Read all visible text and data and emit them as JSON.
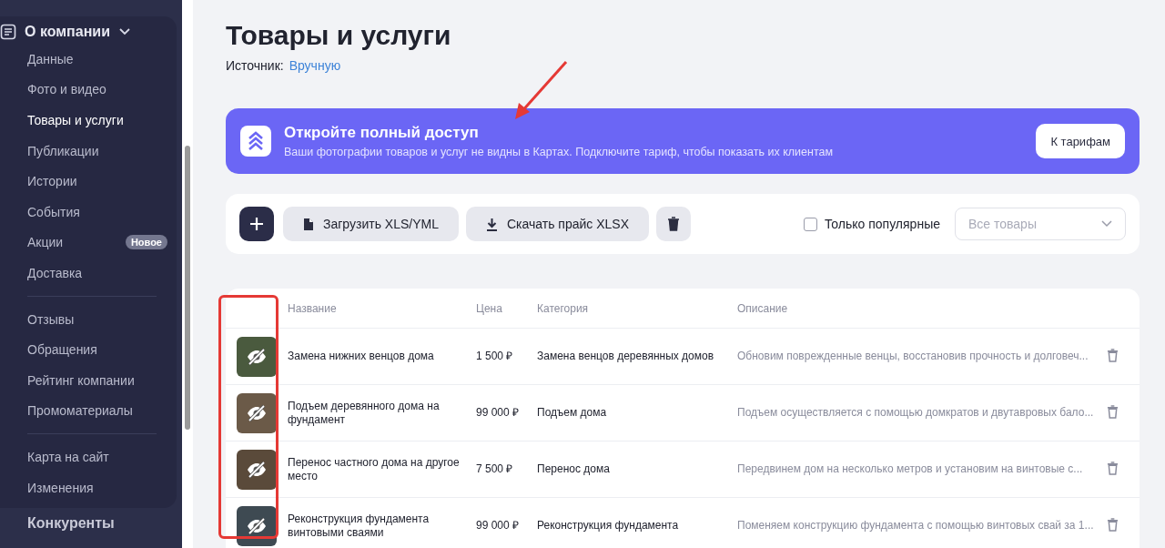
{
  "sidebar": {
    "section": {
      "title": "О компании",
      "expanded": true
    },
    "groups": [
      [
        {
          "label": "Данные",
          "selected": false
        },
        {
          "label": "Фото и видео",
          "selected": false
        },
        {
          "label": "Товары и услуги",
          "selected": true
        },
        {
          "label": "Публикации",
          "selected": false
        },
        {
          "label": "Истории",
          "selected": false
        },
        {
          "label": "События",
          "selected": false
        },
        {
          "label": "Акции",
          "selected": false,
          "badge": "Новое"
        },
        {
          "label": "Доставка",
          "selected": false
        }
      ],
      [
        {
          "label": "Отзывы",
          "selected": false
        },
        {
          "label": "Обращения",
          "selected": false
        },
        {
          "label": "Рейтинг компании",
          "selected": false
        },
        {
          "label": "Промоматериалы",
          "selected": false
        }
      ],
      [
        {
          "label": "Карта на сайт",
          "selected": false
        },
        {
          "label": "Изменения",
          "selected": false
        }
      ]
    ],
    "next_section": "Конкуренты"
  },
  "page": {
    "title": "Товары и услуги",
    "source_label": "Источник:",
    "source_value": "Вручную"
  },
  "banner": {
    "title": "Откройте полный доступ",
    "text": "Ваши фотографии товаров и услуг не видны в Картах. Подключите тариф, чтобы показать их клиентам",
    "button": "К тарифам"
  },
  "toolbar": {
    "upload": "Загрузить XLS/YML",
    "download": "Скачать прайс XLSX",
    "popular": {
      "label": "Только популярные",
      "checked": false
    },
    "filter": {
      "placeholder": "Все товары"
    }
  },
  "table": {
    "columns": [
      "Название",
      "Цена",
      "Категория",
      "Описание"
    ],
    "rows": [
      {
        "name": "Замена нижних венцов дома",
        "price": "1 500 ₽",
        "category": "Замена венцов деревянных домов",
        "description": "Обновим поврежденные венцы, восстановив прочность и долговеч...",
        "hidden": true
      },
      {
        "name": "Подъем деревянного дома на фундамент",
        "price": "99 000 ₽",
        "category": "Подъем дома",
        "description": "Подъем осуществляется с помощью домкратов и двутавровых бало...",
        "hidden": true
      },
      {
        "name": "Перенос частного дома на другое место",
        "price": "7 500 ₽",
        "category": "Перенос дома",
        "description": "Передвинем дом на несколько метров и установим на винтовые с...",
        "hidden": true
      },
      {
        "name": "Реконструкция фундамента винтовыми сваями",
        "price": "99 000 ₽",
        "category": "Реконструкция фундамента",
        "description": "Поменяем конструкцию фундамента с помощью винтовых свай за 1...",
        "hidden": true
      }
    ]
  }
}
